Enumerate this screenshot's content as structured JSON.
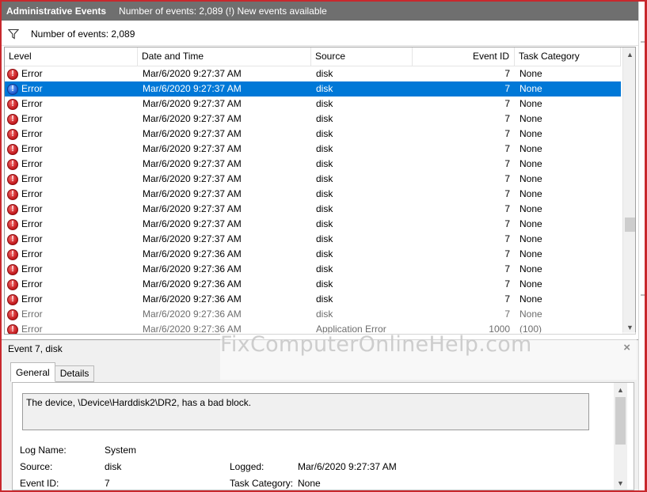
{
  "titlebar": {
    "title": "Administrative Events",
    "status": "Number of events: 2,089 (!) New events available"
  },
  "filter": {
    "icon": "filter-icon",
    "text": "Number of events: 2,089"
  },
  "grid": {
    "columns": [
      "Level",
      "Date and Time",
      "Source",
      "Event ID",
      "Task Category"
    ],
    "rows": [
      {
        "level": "Error",
        "date": "Mar/6/2020 9:27:37 AM",
        "source": "disk",
        "event_id": "7",
        "task": "None"
      },
      {
        "level": "Error",
        "date": "Mar/6/2020 9:27:37 AM",
        "source": "disk",
        "event_id": "7",
        "task": "None",
        "selected": true
      },
      {
        "level": "Error",
        "date": "Mar/6/2020 9:27:37 AM",
        "source": "disk",
        "event_id": "7",
        "task": "None"
      },
      {
        "level": "Error",
        "date": "Mar/6/2020 9:27:37 AM",
        "source": "disk",
        "event_id": "7",
        "task": "None"
      },
      {
        "level": "Error",
        "date": "Mar/6/2020 9:27:37 AM",
        "source": "disk",
        "event_id": "7",
        "task": "None"
      },
      {
        "level": "Error",
        "date": "Mar/6/2020 9:27:37 AM",
        "source": "disk",
        "event_id": "7",
        "task": "None"
      },
      {
        "level": "Error",
        "date": "Mar/6/2020 9:27:37 AM",
        "source": "disk",
        "event_id": "7",
        "task": "None"
      },
      {
        "level": "Error",
        "date": "Mar/6/2020 9:27:37 AM",
        "source": "disk",
        "event_id": "7",
        "task": "None"
      },
      {
        "level": "Error",
        "date": "Mar/6/2020 9:27:37 AM",
        "source": "disk",
        "event_id": "7",
        "task": "None"
      },
      {
        "level": "Error",
        "date": "Mar/6/2020 9:27:37 AM",
        "source": "disk",
        "event_id": "7",
        "task": "None"
      },
      {
        "level": "Error",
        "date": "Mar/6/2020 9:27:37 AM",
        "source": "disk",
        "event_id": "7",
        "task": "None"
      },
      {
        "level": "Error",
        "date": "Mar/6/2020 9:27:37 AM",
        "source": "disk",
        "event_id": "7",
        "task": "None"
      },
      {
        "level": "Error",
        "date": "Mar/6/2020 9:27:36 AM",
        "source": "disk",
        "event_id": "7",
        "task": "None"
      },
      {
        "level": "Error",
        "date": "Mar/6/2020 9:27:36 AM",
        "source": "disk",
        "event_id": "7",
        "task": "None"
      },
      {
        "level": "Error",
        "date": "Mar/6/2020 9:27:36 AM",
        "source": "disk",
        "event_id": "7",
        "task": "None"
      },
      {
        "level": "Error",
        "date": "Mar/6/2020 9:27:36 AM",
        "source": "disk",
        "event_id": "7",
        "task": "None"
      },
      {
        "level": "Error",
        "date": "Mar/6/2020 9:27:36 AM",
        "source": "disk",
        "event_id": "7",
        "task": "None",
        "faded": true
      },
      {
        "level": "Error",
        "date": "Mar/6/2020 9:27:36 AM",
        "source": "Application Error",
        "event_id": "1000",
        "task": "(100)",
        "faded": true
      }
    ]
  },
  "watermark": "FixComputerOnlineHelp.com",
  "details": {
    "header": "Event 7, disk",
    "close_glyph": "×",
    "tabs": [
      "General",
      "Details"
    ],
    "message": "The device, \\Device\\Harddisk2\\DR2, has a bad block.",
    "fields": {
      "log_name_label": "Log Name:",
      "log_name_value": "System",
      "source_label": "Source:",
      "source_value": "disk",
      "logged_label": "Logged:",
      "logged_value": "Mar/6/2020 9:27:37 AM",
      "event_id_label": "Event ID:",
      "event_id_value": "7",
      "task_category_label": "Task Category:",
      "task_category_value": "None"
    }
  },
  "colors": {
    "frame": "#c8282d",
    "titlebar": "#6f6f6f",
    "selection": "#0078d7",
    "error_icon": "#c0171b"
  }
}
